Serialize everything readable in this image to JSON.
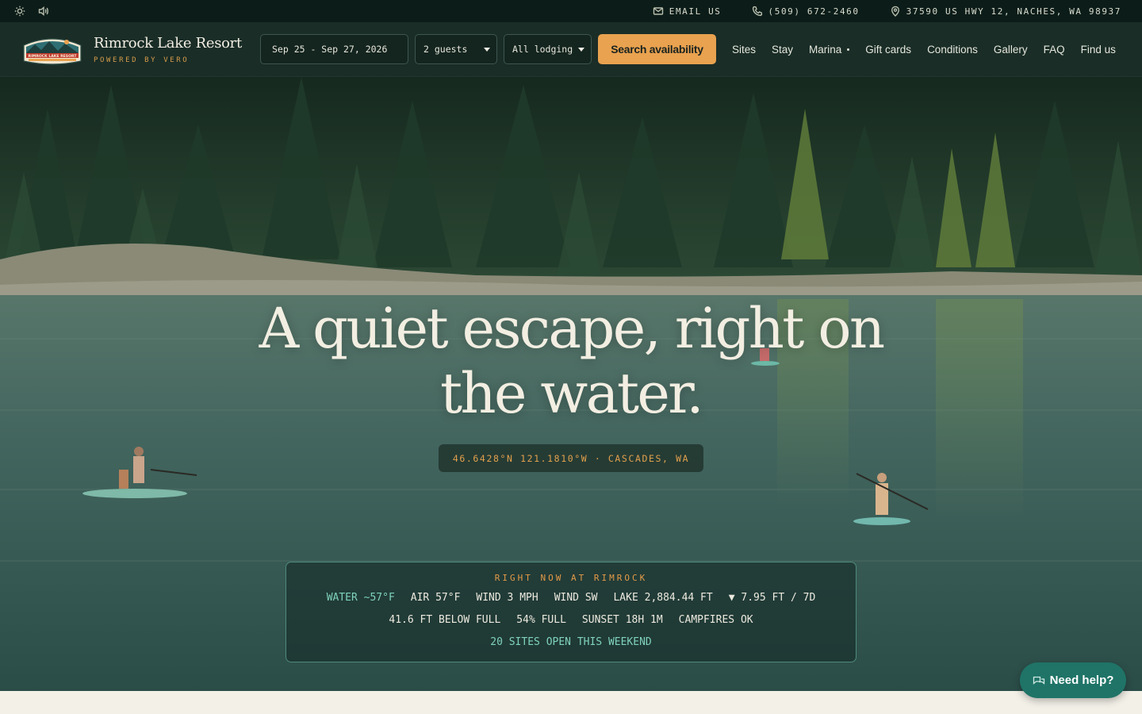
{
  "utility_bar": {
    "email_label": "EMAIL US",
    "phone": "(509) 672-2460",
    "address": "37590 US HWY 12, NACHES, WA 98937",
    "icons": [
      "sun-icon",
      "speaker-icon",
      "mail-icon",
      "phone-icon",
      "map-pin-icon"
    ]
  },
  "brand": {
    "name": "Rimrock Lake Resort",
    "tagline": "POWERED BY VERO",
    "logo_text": "RIMROCK LAKE RESORT"
  },
  "search": {
    "dates": "Sep 25 - Sep 27, 2026",
    "guests": "2 guests",
    "lodging": "All lodging",
    "button_label": "Search availability"
  },
  "nav": {
    "items": [
      {
        "label": "Sites"
      },
      {
        "label": "Stay"
      },
      {
        "label": "Marina"
      },
      {
        "label": "Gift cards"
      },
      {
        "label": "Conditions"
      },
      {
        "label": "Gallery"
      },
      {
        "label": "FAQ"
      },
      {
        "label": "Find us"
      }
    ]
  },
  "hero": {
    "title_line1": "A quiet escape, right on",
    "title_line2": "the water.",
    "coordinates": "46.6428°N 121.1810°W · CASCADES, WA"
  },
  "conditions": {
    "heading": "RIGHT NOW AT RIMROCK",
    "row1": [
      "WATER ~57°F",
      "AIR 57°F",
      "WIND 3 MPH",
      "WIND SW",
      "LAKE 2,884.44 FT",
      "▼ 7.95 FT / 7D"
    ],
    "row2": [
      "41.6 FT BELOW FULL",
      "54% FULL",
      "SUNSET 18H 1M",
      "CAMPFIRES OK"
    ],
    "open_sites": "20 SITES OPEN THIS WEEKEND"
  },
  "help": {
    "label": "Need help?"
  },
  "colors": {
    "topbar": "#0c1d19",
    "navbar": "#1a2d27",
    "accent_orange": "#e9a24f",
    "accent_teal": "#7fd2bc",
    "help_button": "#1f7467"
  }
}
